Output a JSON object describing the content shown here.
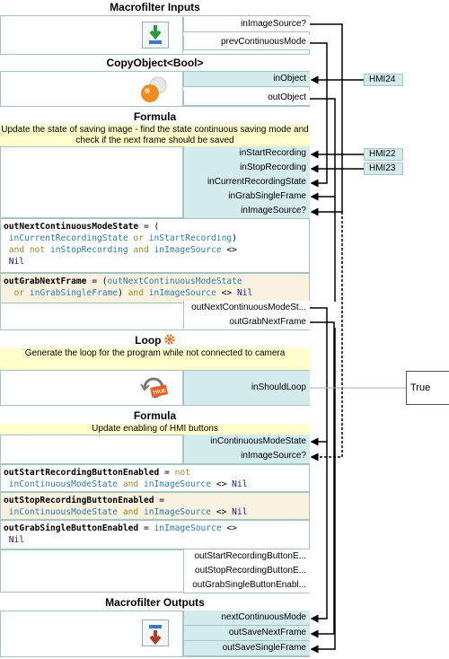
{
  "blocks": {
    "macrofilter_inputs": {
      "title": "Macrofilter Inputs",
      "icon": "download-arrow-icon",
      "ports": [
        "inImageSource?",
        "prevContinuousMode"
      ]
    },
    "copy_object": {
      "title": "CopyObject<Bool>",
      "icon": "copy-spheres-icon",
      "inputs": [
        "inObject"
      ],
      "outputs": [
        "outObject"
      ]
    },
    "formula1": {
      "title": "Formula",
      "comment": "Update the state of  saving image - find the state continuous saving mode and check if the next frame should be saved",
      "inputs": [
        "inStartRecording",
        "inStopRecording",
        "inCurrentRecordingState",
        "inGrabSingleFrame",
        "inImageSource?"
      ],
      "expr1": {
        "name": "outNextContinuousModeState",
        "op": " = (",
        "a": "inCurrentRecordingState",
        "or": " or ",
        "b": "inStartRecording",
        "close": ")",
        "and": "and not ",
        "c": "inStopRecording",
        "and2": " and ",
        "d": "inImageSource",
        "neq": " <>",
        "nil": "Nil"
      },
      "expr2": {
        "name": "outGrabNextFrame",
        "op": " = (",
        "a": "outNextContinuousModeState",
        "or": " or ",
        "b": "inGrabSingleFrame",
        "close": ")",
        "and": " and ",
        "c": "inImageSource",
        "neq": " <> ",
        "nil": "Nil"
      },
      "outputs": [
        "outNextContinuousModeSt...",
        "outGrabNextFrame"
      ]
    },
    "loop": {
      "title": "Loop",
      "comment": "Generate the loop for the program while not connected to camera",
      "icon": "true-sign-icon",
      "icon_text": "TRUE",
      "inputs": [
        "inShouldLoop"
      ],
      "value": "True"
    },
    "formula2": {
      "title": "Formula",
      "comment": "Update enabling of HMI buttons",
      "inputs": [
        "inContinuousModeState",
        "inImageSource?"
      ],
      "expr1": {
        "name": "outStartRecordingButtonEnabled",
        "op": " = ",
        "not": "not",
        "a": "inContinuousModeState",
        "and": " and ",
        "b": "inImageSource",
        "neq": " <> ",
        "nil": "Nil"
      },
      "expr2": {
        "name": "outStopRecordingButtonEnabled",
        "op": " =",
        "a": "inContinuousModeState",
        "and": " and ",
        "b": "inImageSource",
        "neq": " <> ",
        "nil": "Nil"
      },
      "expr3": {
        "name": "outGrabSingleButtonEnabled",
        "op": " = ",
        "a": "inImageSource",
        "neq": " <>",
        "nil": "Nil"
      },
      "outputs": [
        "outStartRecordingButtonE...",
        "outStopRecordingButtonE...",
        "outGrabSingleButtonEnabl..."
      ]
    },
    "macrofilter_outputs": {
      "title": "Macrofilter Outputs",
      "icon": "upload-arrow-icon",
      "ports": [
        "nextContinuousMode",
        "outSaveNextFrame",
        "outSaveSingleFrame"
      ]
    }
  },
  "hmi": [
    "HMI24",
    "HMI22",
    "HMI23"
  ],
  "colors": {
    "port_in": "#d4ecec",
    "border": "#a6c4c4",
    "comment": "#ffffcc",
    "keyword": "#9a8a2a",
    "variable": "#2d7ca8",
    "icon_gear": "#e8731a"
  }
}
